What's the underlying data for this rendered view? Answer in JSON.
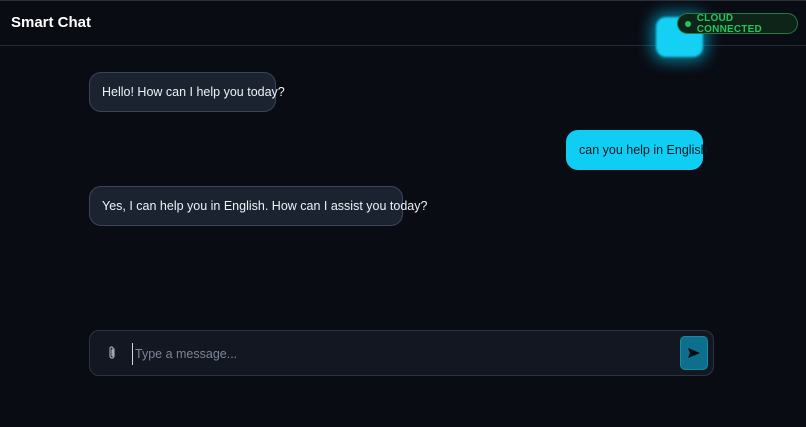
{
  "header": {
    "title": "Smart Chat",
    "status": "CLOUD CONNECTED",
    "status_color": "#22c55e"
  },
  "messages": [
    {
      "role": "assistant",
      "text": "Hello! How can I help you today?"
    },
    {
      "role": "user",
      "text": "can you help in English"
    },
    {
      "role": "assistant",
      "text": "Yes, I can help you in English. How can I assist you today?"
    }
  ],
  "composer": {
    "placeholder": "Type a message...",
    "value": "",
    "attach_icon": "paperclip-icon",
    "send_icon": "send-icon"
  },
  "colors": {
    "background": "#0a0c14",
    "user_bubble": "#10cdf3",
    "assistant_bubble": "#1b2331",
    "send_button": "#0e6f8c"
  }
}
